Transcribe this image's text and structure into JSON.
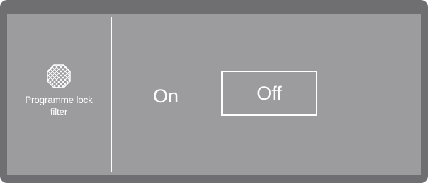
{
  "screen": {
    "program": {
      "icon": "lock-filter-icon",
      "label_line1": "Programme lock",
      "label_line2": "filter"
    },
    "options": [
      {
        "label": "On",
        "selected": false
      },
      {
        "label": "Off",
        "selected": true
      }
    ]
  },
  "colors": {
    "bezel": "#6f6f71",
    "screen": "#9c9c9e",
    "foreground": "#ffffff"
  }
}
